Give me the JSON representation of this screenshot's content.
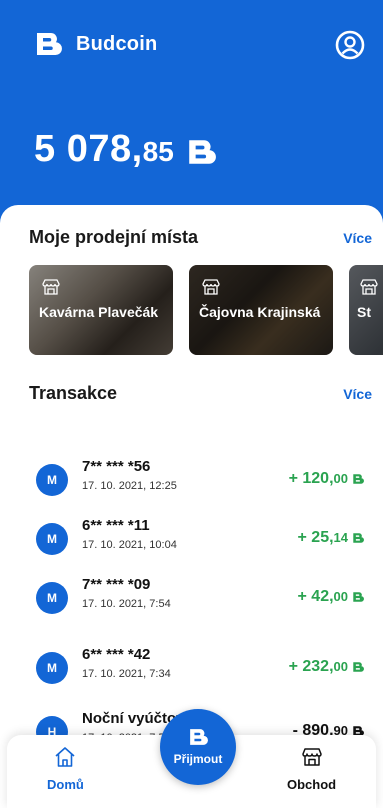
{
  "app": {
    "name": "Budcoin"
  },
  "balance": {
    "integer": "5 078,",
    "decimal": "85"
  },
  "places_section": {
    "title": "Moje prodejní místa",
    "more": "Více",
    "items": [
      {
        "name": "Kavárna Plavečák"
      },
      {
        "name": "Čajovna Krajinská"
      },
      {
        "name": "St"
      }
    ]
  },
  "transactions_section": {
    "title": "Transakce",
    "more": "Více",
    "items": [
      {
        "avatar": "M",
        "title": "7** *** *56",
        "date": "17. 10. 2021, 12:25",
        "amount_main": "+ 120,",
        "amount_dec": "00"
      },
      {
        "avatar": "M",
        "title": "6** *** *11",
        "date": "17. 10. 2021, 10:04",
        "amount_main": "+ 25,",
        "amount_dec": "14"
      },
      {
        "avatar": "M",
        "title": "7** *** *09",
        "date": "17. 10. 2021, 7:54",
        "amount_main": "+ 42,",
        "amount_dec": "00"
      },
      {
        "avatar": "M",
        "title": "6** *** *42",
        "date": "17. 10. 2021, 7:34",
        "amount_main": "+ 232,",
        "amount_dec": "00"
      },
      {
        "avatar": "H",
        "title": "Noční vyúčtování",
        "date": "17. 10. 2021, 7:54",
        "amount_main": "- 890,",
        "amount_dec": "90"
      }
    ]
  },
  "nav": {
    "home": "Domů",
    "receive": "Přijmout",
    "shop": "Obchod"
  },
  "colors": {
    "primary": "#1366d6",
    "positive": "#2aa350"
  },
  "icons": [
    "budcoin-logo-icon",
    "profile-icon",
    "store-icon",
    "home-icon",
    "shop-icon",
    "currency-icon"
  ]
}
